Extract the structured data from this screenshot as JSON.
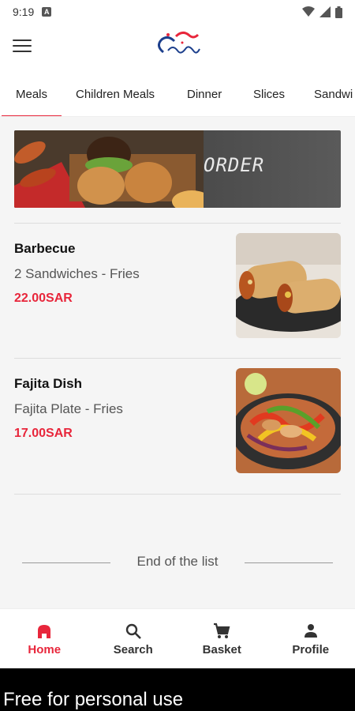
{
  "status": {
    "time": "9:19",
    "notif_icon": "a-icon"
  },
  "header": {
    "menu_icon": "hamburger-icon",
    "logo_icon": "crispy-logo"
  },
  "tabs": [
    {
      "label": "Meals",
      "active": true
    },
    {
      "label": "Children Meals"
    },
    {
      "label": "Dinner"
    },
    {
      "label": "Slices"
    },
    {
      "label": "Sandwi"
    }
  ],
  "banner": {
    "text": "ORDER"
  },
  "items": [
    {
      "name": "Barbecue",
      "description": "2 Sandwiches - Fries",
      "price": "22.00SAR"
    },
    {
      "name": "Fajita Dish",
      "description": "Fajita Plate - Fries",
      "price": "17.00SAR"
    }
  ],
  "end_of_list": "End of the list",
  "bottom_nav": [
    {
      "label": "Home",
      "icon": "home-icon",
      "active": true
    },
    {
      "label": "Search",
      "icon": "search-icon"
    },
    {
      "label": "Basket",
      "icon": "cart-icon"
    },
    {
      "label": "Profile",
      "icon": "person-icon"
    }
  ],
  "watermark": "Free for personal use",
  "colors": {
    "accent": "#e8263b",
    "price": "#e8263b"
  }
}
